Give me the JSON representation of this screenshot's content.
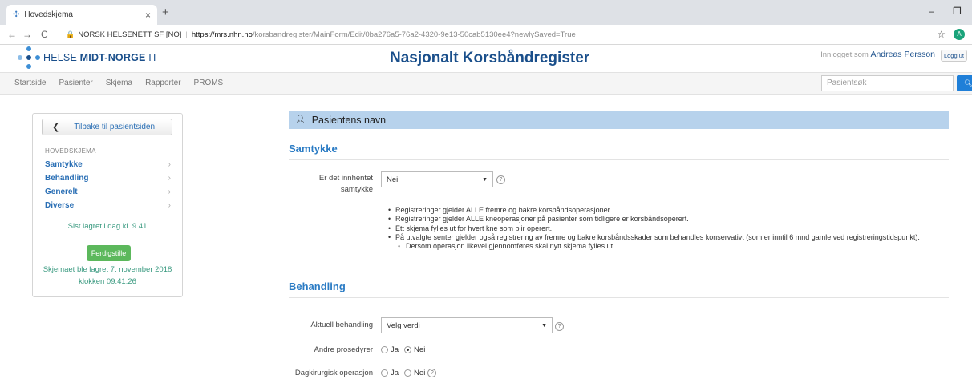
{
  "browser": {
    "tab_title": "Hovedskjema",
    "tab_close": "×",
    "new_tab": "+",
    "minimize": "–",
    "restore": "❐",
    "back": "←",
    "forward": "→",
    "reload": "C",
    "cert": "NORSK HELSENETT SF [NO]",
    "url_host": "https://mrs.nhn.no",
    "url_path": "/korsbandregister/MainForm/Edit/0ba276a5-76a2-4320-9e13-50cab5130ee4?newlySaved=True",
    "bookmark": "☆",
    "profile_initial": "A"
  },
  "header": {
    "logo_prefix": "HELSE ",
    "logo_bold": "MIDT-NORGE",
    "logo_suffix": " IT",
    "title": "Nasjonalt Korsbåndregister",
    "login_prefix": "Innlogget som",
    "user": "Andreas Persson",
    "logout": "Logg ut"
  },
  "nav": {
    "items": [
      "Startside",
      "Pasienter",
      "Skjema",
      "Rapporter",
      "PROMS"
    ],
    "search_placeholder": "Pasientsøk"
  },
  "sidebar": {
    "back_label": "Tilbake til pasientsiden",
    "heading": "HOVEDSKJEMA",
    "items": [
      {
        "label": "Samtykke"
      },
      {
        "label": "Behandling"
      },
      {
        "label": "Generelt"
      },
      {
        "label": "Diverse"
      }
    ],
    "last_saved": "Sist lagret i dag kl. 9.41",
    "finish_label": "Ferdigstille",
    "saved_note_1": "Skjemaet ble lagret 7. november 2018",
    "saved_note_2": "klokken 09:41:26"
  },
  "main": {
    "patient_header": "Pasientens navn",
    "section1": "Samtykke",
    "consent_label_1": "Er det innhentet",
    "consent_label_2": "samtykke",
    "consent_value": "Nei",
    "bullets": [
      "Registreringer gjelder ALLE fremre og bakre korsbåndsoperasjoner",
      "Registreringer gjelder ALLE kneoperasjoner på pasienter som tidligere er korsbåndsoperert.",
      "Ett skjema fylles ut for hvert kne som blir operert.",
      "På utvalgte senter gjelder også registrering av fremre og bakre korsbåndsskader som behandles konservativt (som er inntil 6 mnd gamle ved registreringstidspunkt)."
    ],
    "sub_bullet": "Dersom operasjon likevel gjennomføres skal nytt skjema fylles ut.",
    "section2": "Behandling",
    "treatment_label": "Aktuell behandling",
    "treatment_value": "Velg verdi",
    "other_proc_label": "Andre prosedyrer",
    "day_surgery_label": "Dagkirurgisk operasjon",
    "yes": "Ja",
    "no": "Nei"
  }
}
